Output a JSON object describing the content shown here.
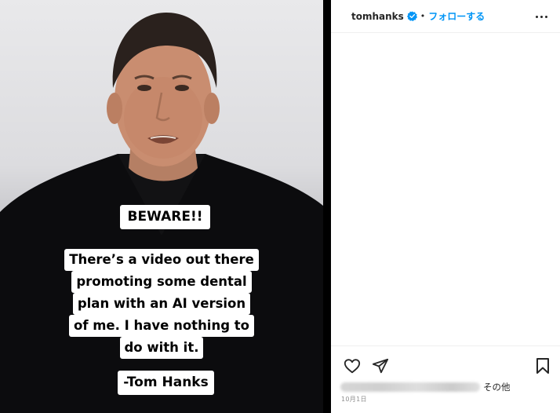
{
  "post": {
    "username": "tomhanks",
    "separator": "•",
    "follow_label": "フォローする",
    "verified_icon": "verified-badge-icon",
    "more_icon": "more-options-icon"
  },
  "media": {
    "caption_beware": "BEWARE!!",
    "caption_lines": [
      "There’s a video out there",
      "promoting some dental",
      "plan with an AI version",
      "of me.  I have nothing to",
      "do with it."
    ],
    "caption_signature": "-Tom Hanks"
  },
  "actions": {
    "like_icon": "heart-icon",
    "share_icon": "send-icon",
    "save_icon": "bookmark-icon"
  },
  "likes": {
    "more_label": "その他"
  },
  "meta": {
    "date": "10月1日"
  },
  "colors": {
    "accent": "#0095f6",
    "verified": "#0095f6",
    "text": "#262626",
    "muted": "#8e8e8e"
  }
}
